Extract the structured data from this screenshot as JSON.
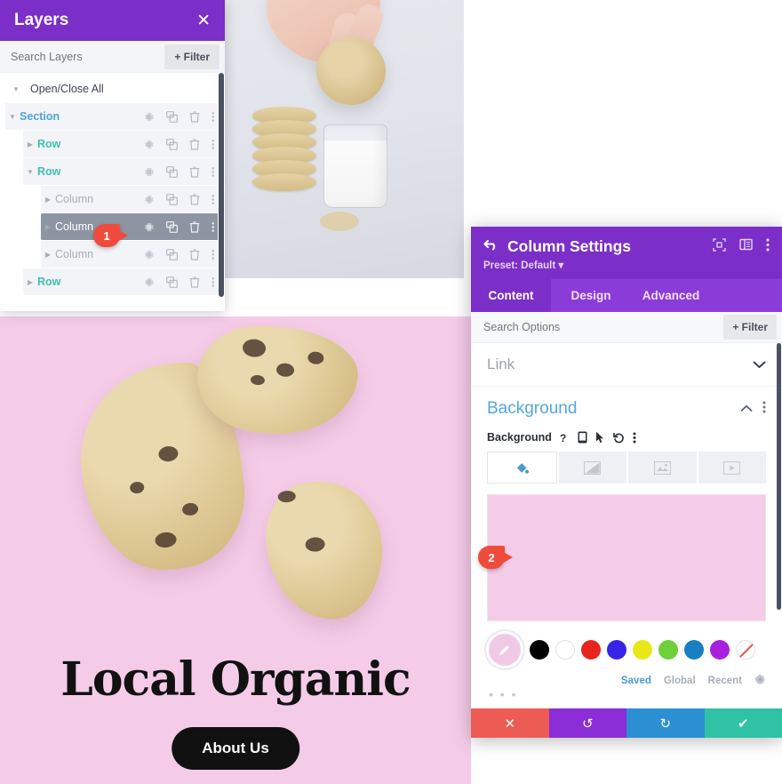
{
  "colors": {
    "purple": "#7b2ec8",
    "purple_light": "#8b3bd8",
    "pink": "#f5cce8",
    "badge_red": "#ef4b3c",
    "section_blue": "#4fa3d9",
    "row_teal": "#3fc0b0",
    "link_blue": "#52a7df"
  },
  "page": {
    "hero_title": "Local Organic",
    "hero_button": "About Us"
  },
  "layers_panel": {
    "title": "Layers",
    "close_label": "✕",
    "search_placeholder": "Search Layers",
    "filter_label": "Filter",
    "open_close_all": "Open/Close All",
    "rows": [
      {
        "label": "Section",
        "type": "section",
        "indent": 0,
        "expanded": true,
        "selected": false
      },
      {
        "label": "Row",
        "type": "row",
        "indent": 1,
        "expanded": false,
        "selected": false
      },
      {
        "label": "Row",
        "type": "row",
        "indent": 1,
        "expanded": true,
        "selected": false
      },
      {
        "label": "Column",
        "type": "column",
        "indent": 2,
        "expanded": false,
        "selected": false
      },
      {
        "label": "Column",
        "type": "column",
        "indent": 2,
        "expanded": false,
        "selected": true
      },
      {
        "label": "Column",
        "type": "column",
        "indent": 2,
        "expanded": false,
        "selected": false
      },
      {
        "label": "Row",
        "type": "row",
        "indent": 1,
        "expanded": false,
        "selected": false
      }
    ],
    "row_icons": [
      "gear-icon",
      "duplicate-icon",
      "trash-icon",
      "more-options-icon"
    ]
  },
  "badges": [
    {
      "number": "1"
    },
    {
      "number": "2"
    }
  ],
  "column_settings": {
    "title": "Column Settings",
    "back_icon": "back-arrow-icon",
    "preset": "Preset: Default",
    "header_icons": [
      "responsive-preview-icon",
      "layout-toggle-icon",
      "more-options-icon"
    ],
    "tabs": [
      {
        "label": "Content",
        "active": true
      },
      {
        "label": "Design",
        "active": false
      },
      {
        "label": "Advanced",
        "active": false
      }
    ],
    "search_placeholder": "Search Options",
    "filter_label": "Filter",
    "link_section": "Link",
    "background": {
      "section_title": "Background",
      "field_label": "Background",
      "field_icons": [
        "help-icon",
        "mobile-icon",
        "hover-icon",
        "reset-icon",
        "more-options-icon"
      ],
      "type_tabs": [
        "background-color-icon",
        "background-gradient-icon",
        "background-image-icon",
        "background-video-icon"
      ],
      "active_type_index": 0,
      "preview_color": "#f5cce8",
      "selected_swatch_color": "#f0c9e4",
      "swatches": [
        {
          "name": "black",
          "hex": "#000000"
        },
        {
          "name": "white",
          "hex": "#ffffff"
        },
        {
          "name": "red",
          "hex": "#e8251c"
        },
        {
          "name": "blue",
          "hex": "#3823e8"
        },
        {
          "name": "yellow",
          "hex": "#e8e818"
        },
        {
          "name": "green",
          "hex": "#6fd039"
        },
        {
          "name": "ocean-blue",
          "hex": "#1880c2"
        },
        {
          "name": "purple",
          "hex": "#a81fe0"
        },
        {
          "name": "transparent",
          "hex": "none"
        }
      ],
      "palette_tabs": [
        {
          "label": "Saved",
          "active": true
        },
        {
          "label": "Global",
          "active": false
        },
        {
          "label": "Recent",
          "active": false
        }
      ],
      "palette_settings_icon": "gear-icon",
      "more_dots": "• • •"
    },
    "actions": [
      {
        "name": "cancel-button",
        "glyph": "✕"
      },
      {
        "name": "undo-button",
        "glyph": "↺"
      },
      {
        "name": "redo-button",
        "glyph": "↻"
      },
      {
        "name": "save-button",
        "glyph": "✔"
      }
    ]
  }
}
